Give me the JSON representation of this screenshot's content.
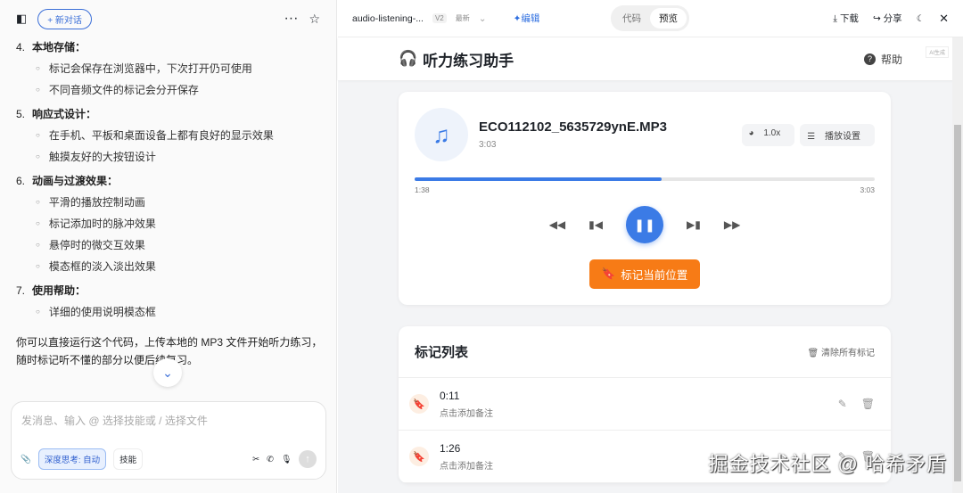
{
  "left": {
    "new_chat": "+ 新对话",
    "sections": [
      {
        "num": "4.",
        "title": "本地存储：",
        "items": [
          "标记会保存在浏览器中，下次打开仍可使用",
          "不同音频文件的标记会分开保存"
        ]
      },
      {
        "num": "5.",
        "title": "响应式设计：",
        "items": [
          "在手机、平板和桌面设备上都有良好的显示效果",
          "触摸友好的大按钮设计"
        ]
      },
      {
        "num": "6.",
        "title": "动画与过渡效果：",
        "items": [
          "平滑的播放控制动画",
          "标记添加时的脉冲效果",
          "悬停时的微交互效果",
          "模态框的淡入淡出效果"
        ]
      },
      {
        "num": "7.",
        "title": "使用帮助：",
        "items": [
          "详细的使用说明模态框"
        ]
      }
    ],
    "paragraph": "你可以直接运行这个代码，上传本地的 MP3 文件开始听力练习，随时标记听不懂的部分以便后续复习。",
    "input_placeholder": "发消息、输入 @ 选择技能或 / 选择文件",
    "deep_think": "深度思考: 自动",
    "skills": "技能"
  },
  "topbar": {
    "file": "audio-listening-...",
    "version": "V2",
    "latest": "最新",
    "edit": "编辑",
    "tab_code": "代码",
    "tab_preview": "预览",
    "download": "下载",
    "share": "分享"
  },
  "app": {
    "title": "听力练习助手",
    "help": "帮助",
    "ai_tag": "AI生成",
    "player": {
      "filename": "ECO112102_5635729ynE.MP3",
      "duration": "3:03",
      "speed": "1.0x",
      "settings": "播放设置",
      "current": "1:38",
      "total": "3:03",
      "progress_percent": 53.6,
      "mark_button": "标记当前位置"
    },
    "marks": {
      "title": "标记列表",
      "clear": "清除所有标记",
      "items": [
        {
          "time": "0:11",
          "note": "点击添加备注"
        },
        {
          "time": "1:26",
          "note": "点击添加备注"
        }
      ]
    }
  },
  "watermark": "掘金技术社区 @ 哈希矛盾"
}
